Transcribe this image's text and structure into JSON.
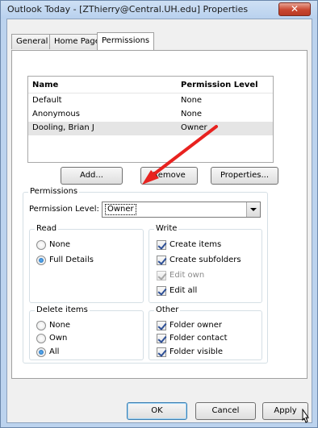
{
  "window": {
    "title": "Outlook Today - [ZThierry@Central.UH.edu] Properties",
    "close_glyph": "✕"
  },
  "tabs": [
    {
      "label": "General"
    },
    {
      "label": "Home Page"
    },
    {
      "label": "Permissions",
      "active": true
    }
  ],
  "list": {
    "headers": {
      "name": "Name",
      "level": "Permission Level"
    },
    "rows": [
      {
        "name": "Default",
        "level": "None"
      },
      {
        "name": "Anonymous",
        "level": "None"
      },
      {
        "name": "Dooling, Brian J",
        "level": "Owner",
        "selected": true
      }
    ]
  },
  "list_buttons": {
    "add": "Add...",
    "remove": "Remove",
    "properties": "Properties..."
  },
  "permissions": {
    "title": "Permissions",
    "level_label": "Permission Level:",
    "level_value": "Owner",
    "read": {
      "title": "Read",
      "none": "None",
      "full": "Full Details",
      "selected": "Full Details"
    },
    "write": {
      "title": "Write",
      "create_items": "Create items",
      "create_subfolders": "Create subfolders",
      "edit_own": "Edit own",
      "edit_all": "Edit all"
    },
    "delete": {
      "title": "Delete items",
      "none": "None",
      "own": "Own",
      "all": "All",
      "selected": "All"
    },
    "other": {
      "title": "Other",
      "folder_owner": "Folder owner",
      "folder_contact": "Folder contact",
      "folder_visible": "Folder visible"
    }
  },
  "footer": {
    "ok": "OK",
    "cancel": "Cancel",
    "apply": "Apply"
  },
  "colors": {
    "annotation_arrow": "#e8221f"
  }
}
